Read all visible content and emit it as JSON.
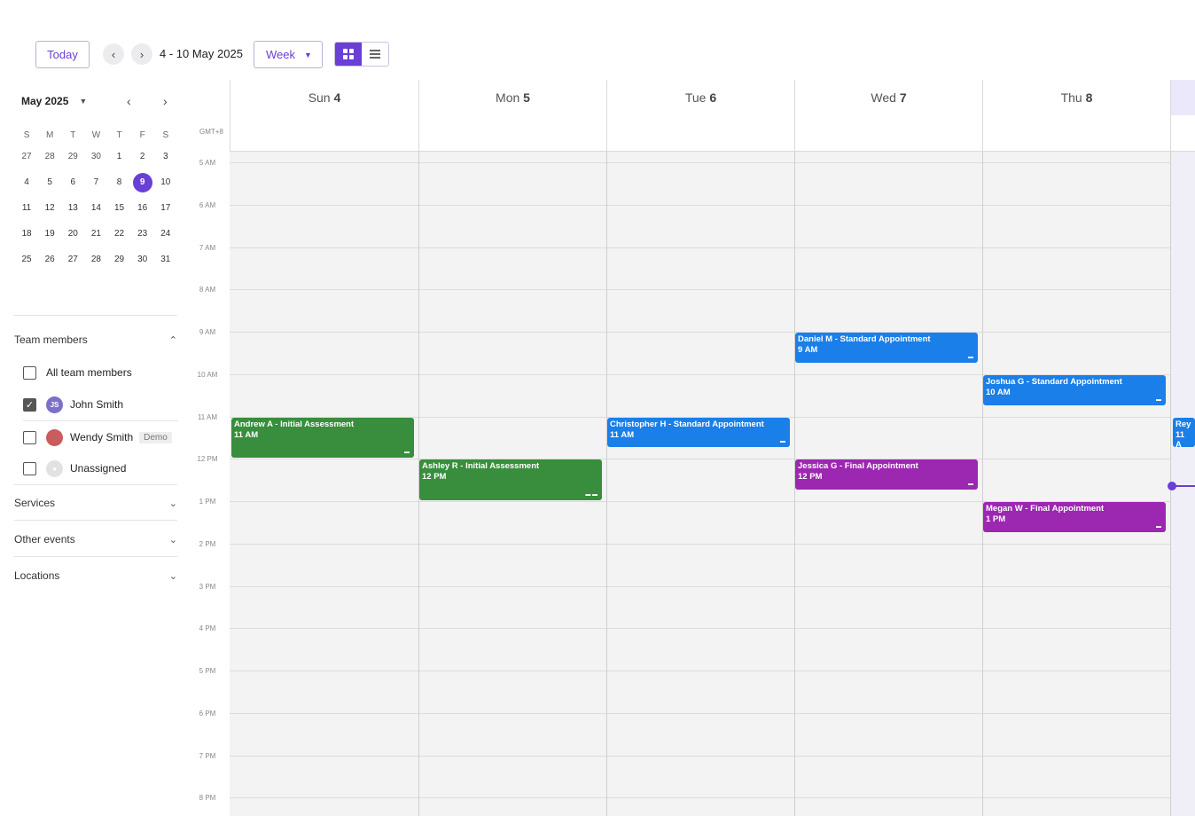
{
  "toolbar": {
    "today_label": "Today",
    "prev_icon": "‹",
    "next_icon": "›",
    "range": "4 - 10 May 2025",
    "view_label": "Week",
    "caret": "▼"
  },
  "mini_calendar": {
    "month_label": "May 2025",
    "caret": "▼",
    "prev": "‹",
    "next": "›",
    "dows": [
      "S",
      "M",
      "T",
      "W",
      "T",
      "F",
      "S"
    ],
    "weeks": [
      [
        "27",
        "28",
        "29",
        "30",
        "1",
        "2",
        "3"
      ],
      [
        "4",
        "5",
        "6",
        "7",
        "8",
        "9",
        "10"
      ],
      [
        "11",
        "12",
        "13",
        "14",
        "15",
        "16",
        "17"
      ],
      [
        "18",
        "19",
        "20",
        "21",
        "22",
        "23",
        "24"
      ],
      [
        "25",
        "26",
        "27",
        "28",
        "29",
        "30",
        "31"
      ]
    ],
    "today": "9"
  },
  "sidebar": {
    "team_members_label": "Team members",
    "all_members_label": "All team members",
    "members": [
      {
        "name": "John Smith",
        "initials": "JS",
        "checked": true
      },
      {
        "name": "Wendy Smith",
        "badge": "Demo",
        "checked": false
      },
      {
        "name": "Unassigned",
        "checked": false
      }
    ],
    "services_label": "Services",
    "other_events_label": "Other events",
    "locations_label": "Locations",
    "chev_up": "⌃",
    "chev_down": "⌄"
  },
  "calendar": {
    "timezone": "GMT+8",
    "days": [
      {
        "name": "Sun",
        "num": "4"
      },
      {
        "name": "Mon",
        "num": "5"
      },
      {
        "name": "Tue",
        "num": "6"
      },
      {
        "name": "Wed",
        "num": "7"
      },
      {
        "name": "Thu",
        "num": "8"
      }
    ],
    "hours": [
      "5 AM",
      "6 AM",
      "7 AM",
      "8 AM",
      "9 AM",
      "10 AM",
      "11 AM",
      "12 PM",
      "1 PM",
      "2 PM",
      "3 PM",
      "4 PM",
      "5 PM",
      "6 PM",
      "7 PM",
      "8 PM"
    ],
    "events": [
      {
        "title": "Andrew A - Initial Assessment",
        "time": "11 AM",
        "color": "#388e3c",
        "day": 0,
        "start_hour": 11.0,
        "duration": 1.0,
        "icons": "▬"
      },
      {
        "title": "Ashley R - Initial Assessment",
        "time": "12 PM",
        "color": "#388e3c",
        "day": 1,
        "start_hour": 12.0,
        "duration": 1.0,
        "icons": "▬ ▬"
      },
      {
        "title": "Christopher H - Standard Appointment",
        "time": "11 AM",
        "color": "#1a7fe8",
        "day": 2,
        "start_hour": 11.0,
        "duration": 0.75,
        "icons": "▬"
      },
      {
        "title": "Daniel M - Standard Appointment",
        "time": "9 AM",
        "color": "#1a7fe8",
        "day": 3,
        "start_hour": 9.0,
        "duration": 0.75,
        "icons": "▬"
      },
      {
        "title": "Jessica G - Final Appointment",
        "time": "12 PM",
        "color": "#9c27b0",
        "day": 3,
        "start_hour": 12.0,
        "duration": 0.75,
        "icons": "▬"
      },
      {
        "title": "Joshua G - Standard Appointment",
        "time": "10 AM",
        "color": "#1a7fe8",
        "day": 4,
        "start_hour": 10.0,
        "duration": 0.75,
        "icons": "▬"
      },
      {
        "title": "Megan W - Final Appointment",
        "time": "1 PM",
        "color": "#9c27b0",
        "day": 4,
        "start_hour": 13.0,
        "duration": 0.75,
        "icons": "▬"
      },
      {
        "title": "Rey",
        "time": "11 A",
        "color": "#1a7fe8",
        "day": 5,
        "start_hour": 11.0,
        "duration": 0.75,
        "icons": ""
      }
    ]
  }
}
